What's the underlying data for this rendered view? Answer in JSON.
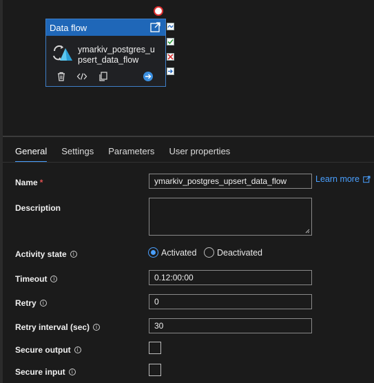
{
  "canvas": {
    "activity": {
      "type_label": "Data flow",
      "name": "ymarkiv_postgres_upsert_data_flow"
    }
  },
  "tabs": [
    {
      "label": "General",
      "active": true
    },
    {
      "label": "Settings"
    },
    {
      "label": "Parameters"
    },
    {
      "label": "User properties"
    }
  ],
  "form": {
    "name": {
      "label": "Name",
      "required_mark": "*",
      "value": "ymarkiv_postgres_upsert_data_flow"
    },
    "learn_more": "Learn more",
    "description": {
      "label": "Description",
      "value": ""
    },
    "activity_state": {
      "label": "Activity state",
      "options": [
        "Activated",
        "Deactivated"
      ],
      "selected": "Activated"
    },
    "timeout": {
      "label": "Timeout",
      "value": "0.12:00:00"
    },
    "retry": {
      "label": "Retry",
      "value": "0"
    },
    "retry_interval": {
      "label": "Retry interval (sec)",
      "value": "30"
    },
    "secure_output": {
      "label": "Secure output",
      "checked": false
    },
    "secure_input": {
      "label": "Secure input",
      "checked": false
    }
  },
  "info_glyph": "i",
  "colors": {
    "accent": "#4aa0ff",
    "header_blue": "#1f67b8",
    "background": "#1b1b1b",
    "success": "#2e9e3c",
    "failure": "#d83b3b"
  }
}
